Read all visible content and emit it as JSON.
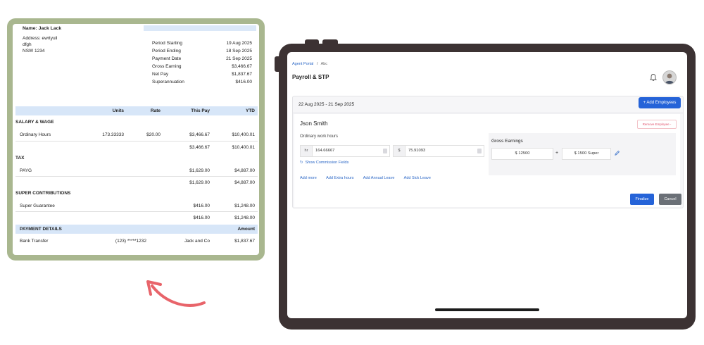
{
  "payslip": {
    "name": "Name: Jack Lack",
    "address_label": "Address: ewrtyuil",
    "address_line2": "dfgh",
    "address_line3": "NSW 1234",
    "info": [
      {
        "label": "Period Starting",
        "value": "19 Aug 2025"
      },
      {
        "label": "Period Ending",
        "value": "18 Sep 2025"
      },
      {
        "label": "Payment Date",
        "value": "21 Sep 2025"
      },
      {
        "label": "Gross Earning",
        "value": "$3,466.67"
      },
      {
        "label": "Net Pay",
        "value": "$1,837.67"
      },
      {
        "label": "Superannuation",
        "value": "$416.00"
      }
    ],
    "columns": {
      "units": "Units",
      "rate": "Rate",
      "this_pay": "This Pay",
      "ytd": "YTD"
    },
    "salary_section": "SALARY & WAGE",
    "salary_row": {
      "label": "Ordinary Hours",
      "units": "173.33333",
      "rate": "$20.00",
      "this_pay": "$3,466.67",
      "ytd": "$10,400.01"
    },
    "salary_total": {
      "this_pay": "$3,466.67",
      "ytd": "$10,400.01"
    },
    "tax_section": "TAX",
    "tax_row": {
      "label": "PAYG",
      "this_pay": "$1,629.00",
      "ytd": "$4,887.00"
    },
    "tax_total": {
      "this_pay": "$1,629.00",
      "ytd": "$4,887.00"
    },
    "super_section": "SUPER CONTRIBUTIONS",
    "super_row": {
      "label": "Super Guarantee",
      "this_pay": "$416.00",
      "ytd": "$1,248.00"
    },
    "super_total": {
      "this_pay": "$416.00",
      "ytd": "$1,248.00"
    },
    "payment_header": {
      "label": "PAYMENT DETAILS",
      "amount": "Amount"
    },
    "payment_row": {
      "method": "Bank Transfer",
      "account": "(123) *****1232",
      "name": "Jack and Co",
      "amount": "$1,837.67"
    }
  },
  "app": {
    "breadcrumb": {
      "parent": "Agent Portal",
      "separator": "/",
      "current": "Abc"
    },
    "title": "Payroll & STP",
    "period": "22 Aug 2025 - 21 Sep 2025",
    "add_employees": "+ Add Employees",
    "employee": {
      "name": "Json Smith",
      "remove": "Remove Employee -",
      "ordinary_hours_label": "Ordinary work hours",
      "hours_prefix": "hr",
      "hours_value": "164.66667",
      "rate_prefix": "$",
      "rate_value": "75.91093",
      "show_commission": "Show Commission Fields",
      "gross_label": "Gross Earnings",
      "gross_value": "$ 12500",
      "plus": "+",
      "super_value": "$ 1500 Super",
      "links": [
        "Add more",
        "Add Extra hours",
        "Add Annual Leave",
        "Add Sick Leave"
      ]
    },
    "finalize": "Finalize",
    "cancel": "Cancel"
  },
  "colors": {
    "accent": "#2563d8",
    "payslip_border": "#a9b78f",
    "tablet": "#3c3233",
    "arrow": "#e8646a"
  }
}
